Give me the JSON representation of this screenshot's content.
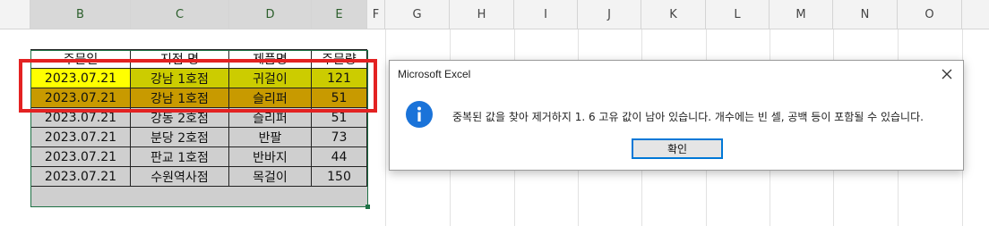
{
  "column_headers": [
    {
      "id": "B",
      "label": "B"
    },
    {
      "id": "C",
      "label": "C"
    },
    {
      "id": "D",
      "label": "D"
    },
    {
      "id": "E",
      "label": "E"
    },
    {
      "id": "F",
      "label": "F"
    },
    {
      "id": "G",
      "label": "G"
    },
    {
      "id": "H",
      "label": "H"
    },
    {
      "id": "I",
      "label": "I"
    },
    {
      "id": "J",
      "label": "J"
    },
    {
      "id": "K",
      "label": "K"
    },
    {
      "id": "L",
      "label": "L"
    },
    {
      "id": "M",
      "label": "M"
    },
    {
      "id": "N",
      "label": "N"
    },
    {
      "id": "O",
      "label": "O"
    }
  ],
  "table": {
    "headers": [
      "주문일",
      "지점 명",
      "제품명",
      "주문량"
    ],
    "rows": [
      {
        "date": "2023.07.21",
        "branch": "강남 1호점",
        "product": "귀걸이",
        "qty": "121",
        "style": "highlight-1"
      },
      {
        "date": "2023.07.21",
        "branch": "강남 1호점",
        "product": "슬리퍼",
        "qty": "51",
        "style": "highlight-2"
      },
      {
        "date": "2023.07.21",
        "branch": "강동 2호점",
        "product": "슬리퍼",
        "qty": "51",
        "style": "gray"
      },
      {
        "date": "2023.07.21",
        "branch": "분당 2호점",
        "product": "반팔",
        "qty": "73",
        "style": "gray"
      },
      {
        "date": "2023.07.21",
        "branch": "판교 1호점",
        "product": "반바지",
        "qty": "44",
        "style": "gray"
      },
      {
        "date": "2023.07.21",
        "branch": "수원역사점",
        "product": "목걸이",
        "qty": "150",
        "style": "gray"
      }
    ]
  },
  "dialog": {
    "title": "Microsoft Excel",
    "message": "중복된 값을 찾아 제거하지 1. 6 고유 값이 남아 있습니다. 개수에는 빈 셀, 공백 등이 포함될 수 있습니다.",
    "ok_label": "확인",
    "icon": "info-icon",
    "close_icon": "close-icon"
  },
  "colors": {
    "highlight_date": "#ffff00",
    "highlight_olive": "#cccc00",
    "highlight_gold": "#c89a00",
    "row_gray": "#cfcfcf",
    "annotation_box": "#e32222",
    "selection_border": "#1e7145",
    "dialog_accent": "#0078d7"
  }
}
